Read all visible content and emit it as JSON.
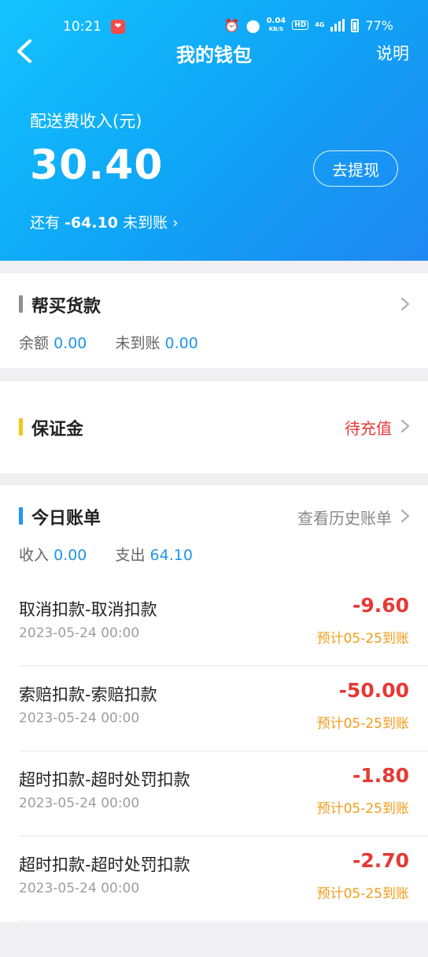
{
  "status_bar": {
    "time": "10:21",
    "net_speed_value": "0.04",
    "net_speed_unit": "KB/S",
    "hd": "HD",
    "signal": "4G",
    "battery": "77%"
  },
  "nav": {
    "title": "我的钱包",
    "help": "说明"
  },
  "wallet": {
    "fee_label": "配送费收入(元)",
    "fee_amount": "30.40",
    "withdraw_label": "去提现",
    "pending_prefix": "还有 ",
    "pending_amount": "-64.10",
    "pending_suffix": " 未到账",
    "pending_arrow": "›"
  },
  "purchase": {
    "title": "帮买货款",
    "balance_label": "余额",
    "balance_value": "0.00",
    "unsettled_label": "未到账",
    "unsettled_value": "0.00"
  },
  "deposit": {
    "title": "保证金",
    "status": "待充值"
  },
  "today": {
    "title": "今日账单",
    "history_link": "查看历史账单",
    "income_label": "收入",
    "income_value": "0.00",
    "expense_label": "支出",
    "expense_value": "64.10",
    "bills": [
      {
        "name": "取消扣款-取消扣款",
        "date": "2023-05-24 00:00",
        "amount": "-9.60",
        "eta": "预计05-25到账"
      },
      {
        "name": "索赔扣款-索赔扣款",
        "date": "2023-05-24 00:00",
        "amount": "-50.00",
        "eta": "预计05-25到账"
      },
      {
        "name": "超时扣款-超时处罚扣款",
        "date": "2023-05-24 00:00",
        "amount": "-1.80",
        "eta": "预计05-25到账"
      },
      {
        "name": "超时扣款-超时处罚扣款",
        "date": "2023-05-24 00:00",
        "amount": "-2.70",
        "eta": "预计05-25到账"
      }
    ]
  },
  "colors": {
    "header_start": "#14c3ff",
    "header_end": "#1f87f2",
    "amount_red": "#e53935",
    "value_blue": "#1f95e8",
    "eta_orange": "#f29c19",
    "deposit_bar": "#f5c518",
    "today_bar": "#2196f3"
  },
  "icons": {
    "back": "chevron-left-icon",
    "row_arrow": "chevron-right-icon",
    "alarm": "alarm-icon",
    "location": "location-icon",
    "battery": "battery-icon",
    "app": "app-heart-icon"
  }
}
